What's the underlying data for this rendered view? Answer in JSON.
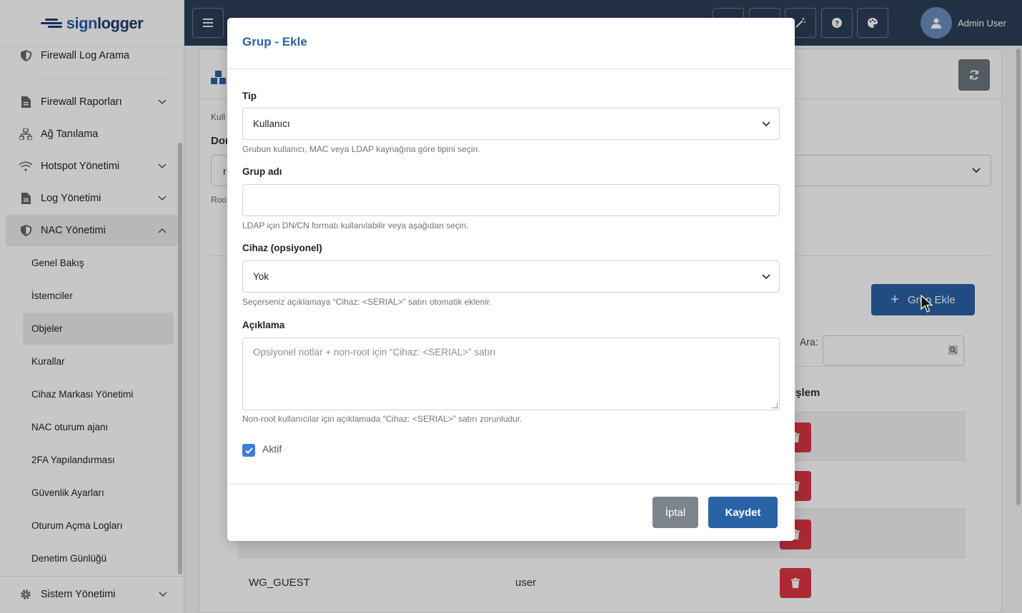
{
  "brand": {
    "name_a": "sign",
    "name_b": "logger"
  },
  "sidebar": {
    "items": [
      {
        "label": "Firewall Log Arama"
      },
      {
        "label": "Firewall Raporları"
      },
      {
        "label": "Ağ Tanılama"
      },
      {
        "label": "Hotspot Yönetimi"
      },
      {
        "label": "Log Yönetimi"
      },
      {
        "label": "NAC Yönetimi"
      }
    ],
    "sub_items": [
      {
        "label": "Genel Bakış"
      },
      {
        "label": "İstemciler"
      },
      {
        "label": "Objeler"
      },
      {
        "label": "Kurallar"
      },
      {
        "label": "Cihaz Markası Yönetimi"
      },
      {
        "label": "NAC oturum ajanı"
      },
      {
        "label": "2FA Yapılandırması"
      },
      {
        "label": "Güvenlik Ayarları"
      },
      {
        "label": "Oturum Açma Logları"
      },
      {
        "label": "Denetim Günlüğü"
      }
    ],
    "bottom_item": "Sistem Yönetimi"
  },
  "topbar": {
    "user": "Admin User"
  },
  "background": {
    "frag_kull": "Kull",
    "frag_dom": "Dom",
    "frag_r": "r",
    "frag_roo": "Roo",
    "add_button": "Grup Ekle",
    "search_label": "Ara:",
    "col_action": "İşlem",
    "rows": [
      {
        "name": "",
        "type": ""
      },
      {
        "name": "",
        "type": ""
      },
      {
        "name": "",
        "type": ""
      },
      {
        "name": "WG_GUEST",
        "type": "user"
      }
    ]
  },
  "modal": {
    "title": "Grup - Ekle",
    "type_label": "Tip",
    "type_value": "Kullanıcı",
    "type_help": "Grubun kullanıcı, MAC veya LDAP kaynağına göre tipini seçin.",
    "group_label": "Grup adı",
    "group_value": "",
    "group_help": "LDAP için DN/CN formatı kullanılabilir veya aşağıdan seçin.",
    "device_label": "Cihaz (opsiyonel)",
    "device_value": "Yok",
    "device_help": "Seçerseniz açıklamaya “Cihaz: <SERIAL>” satırı otomatik eklenir.",
    "desc_label": "Açıklama",
    "desc_placeholder": "Opsiyonel notlar + non-root için “Cihaz: <SERIAL>” satırı",
    "desc_help": "Non-root kullanıcılar için açıklamada “Cihaz: <SERIAL>” satırı zorunludur.",
    "active_label": "Aktif",
    "active_checked": true,
    "cancel": "İptal",
    "save": "Kaydet"
  }
}
